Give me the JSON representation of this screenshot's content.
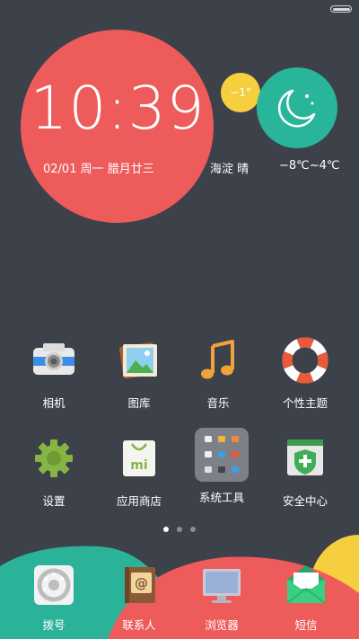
{
  "status_bar": {
    "battery": "full"
  },
  "clock": {
    "time": "10:39",
    "date": "02/01 周一 腊月廿三"
  },
  "weather": {
    "temp_now": "−1°",
    "location_condition": "海淀 晴",
    "range": "−8℃~4℃",
    "icon": "moon-stars-icon"
  },
  "apps": [
    {
      "label": "相机",
      "icon": "camera-icon"
    },
    {
      "label": "图库",
      "icon": "gallery-icon"
    },
    {
      "label": "音乐",
      "icon": "music-note-icon"
    },
    {
      "label": "个性主题",
      "icon": "lifebuoy-icon"
    },
    {
      "label": "设置",
      "icon": "gear-icon"
    },
    {
      "label": "应用商店",
      "icon": "mi-store-icon"
    },
    {
      "label": "系统工具",
      "icon": "folder-icon"
    },
    {
      "label": "安全中心",
      "icon": "shield-icon"
    }
  ],
  "page_indicator": {
    "pages": 3,
    "current": 1
  },
  "dock": [
    {
      "label": "拨号",
      "icon": "rotary-phone-icon"
    },
    {
      "label": "联系人",
      "icon": "contacts-book-icon"
    },
    {
      "label": "浏览器",
      "icon": "monitor-icon"
    },
    {
      "label": "短信",
      "icon": "envelope-icon"
    }
  ],
  "colors": {
    "background": "#3d414a",
    "clock_red": "#ee5b5b",
    "weather_teal": "#29b59a",
    "temp_yellow": "#f5cf3e",
    "dock_teal": "#2bb39a",
    "dock_red": "#ee5b5b"
  }
}
